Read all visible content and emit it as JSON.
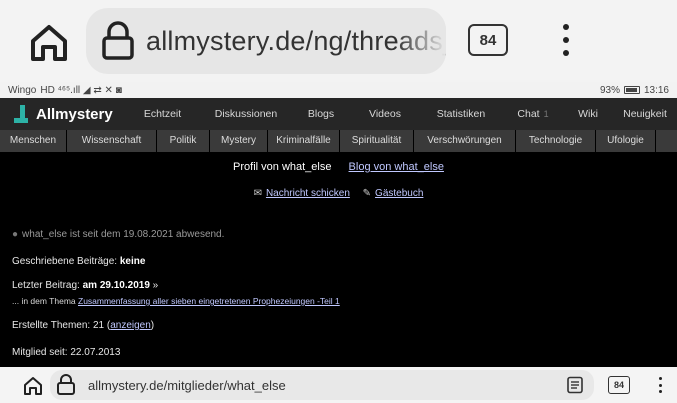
{
  "top_browser": {
    "url": "allmystery.de/ng/threads_user",
    "tab_count": "84"
  },
  "statusbar": {
    "carrier": "Wingo",
    "signal_text": "HD ⁴⁶⁵.ıll ◢ ⇄ ✕ ◙",
    "battery": "93%",
    "time": "13:16"
  },
  "site": {
    "logo": "Allmystery",
    "nav": [
      "Echtzeit",
      "Diskussionen",
      "Blogs",
      "Videos",
      "Statistiken",
      "Chat",
      "Wiki",
      "Neuigkeit"
    ],
    "chat_badge": "1",
    "categories": [
      "Menschen",
      "Wissenschaft",
      "Politik",
      "Mystery",
      "Kriminalfälle",
      "Spiritualität",
      "Verschwörungen",
      "Technologie",
      "Ufologie"
    ]
  },
  "profile": {
    "title": "Profil von what_else",
    "blog_link": "Blog von what_else",
    "message_link": "Nachricht schicken",
    "guestbook_link": "Gästebuch",
    "absent_text": "what_else ist seit dem 19.08.2021 abwesend.",
    "posts_label": "Geschriebene Beiträge:",
    "posts_value": "keine",
    "last_label": "Letzter Beitrag:",
    "last_value": "am 29.10.2019",
    "last_arrow": "»",
    "thread_prefix": "... in dem Thema",
    "thread_link": "Zusammenfassung aller sieben eingetretenen Prophezeiungen -Teil 1",
    "themes_label": "Erstellte Themen: 21",
    "themes_link": "anzeigen",
    "member_label": "Mitglied seit:",
    "member_value": "22.07.2013"
  },
  "bottom_browser": {
    "url": "allmystery.de/mitglieder/what_else",
    "tab_count": "84"
  }
}
